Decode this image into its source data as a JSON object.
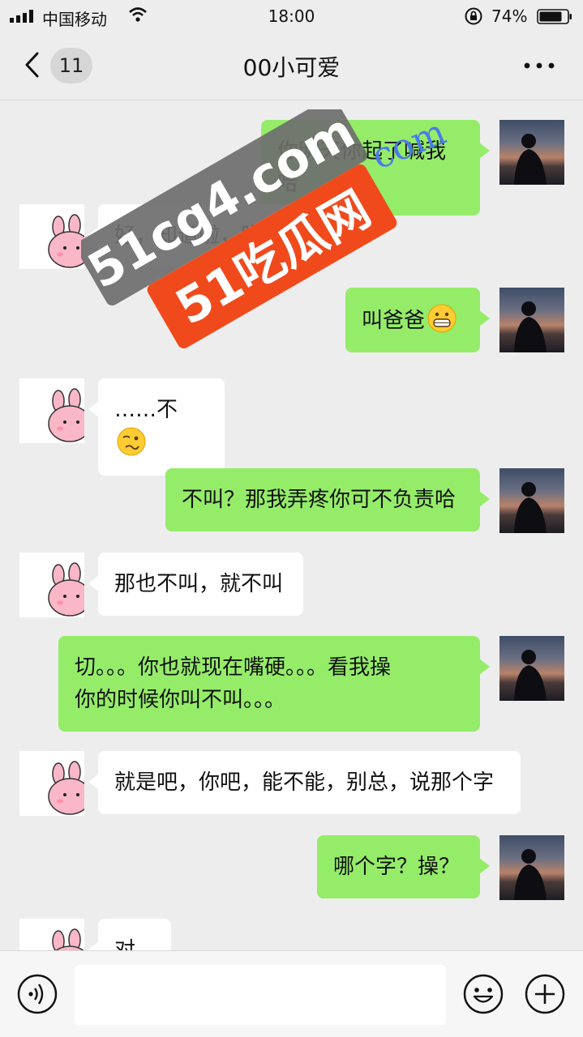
{
  "status_bar": {
    "carrier": "中国移动",
    "time": "18:00",
    "battery": "74%"
  },
  "nav": {
    "unread_count": "11",
    "title": "00小可爱"
  },
  "messages": [
    {
      "side": "me",
      "text": "你明天你起了喊我哈"
    },
    {
      "side": "them",
      "text": "好，知道啦，晚安"
    },
    {
      "side": "me",
      "text": "叫爸爸",
      "emoji": "grinning-face-emoji"
    },
    {
      "side": "them",
      "text": "……不",
      "emoji": "woozy-face-emoji"
    },
    {
      "side": "me",
      "text": "不叫？那我弄疼你可不负责哈"
    },
    {
      "side": "them",
      "text": "那也不叫，就不叫"
    },
    {
      "side": "me",
      "line1": "切。。。你也就现在嘴硬。。。看我操",
      "line2": "你的时候你叫不叫。。。"
    },
    {
      "side": "them",
      "text": "就是吧，你吧，能不能，别总，说那个字"
    },
    {
      "side": "me",
      "text": "哪个字？操？"
    },
    {
      "side": "them",
      "text": "对"
    }
  ],
  "watermark": {
    "line1": "51cg4.com",
    "line2": "51吃瓜网",
    "line3": "com"
  },
  "input": {
    "value": ""
  },
  "colors": {
    "background": "#ededed",
    "my_bubble": "#95ec69",
    "their_bubble": "#ffffff",
    "watermark_dark": "#6e6e6e",
    "watermark_red": "#f04a1c",
    "watermark_blue": "#4a7be8"
  }
}
